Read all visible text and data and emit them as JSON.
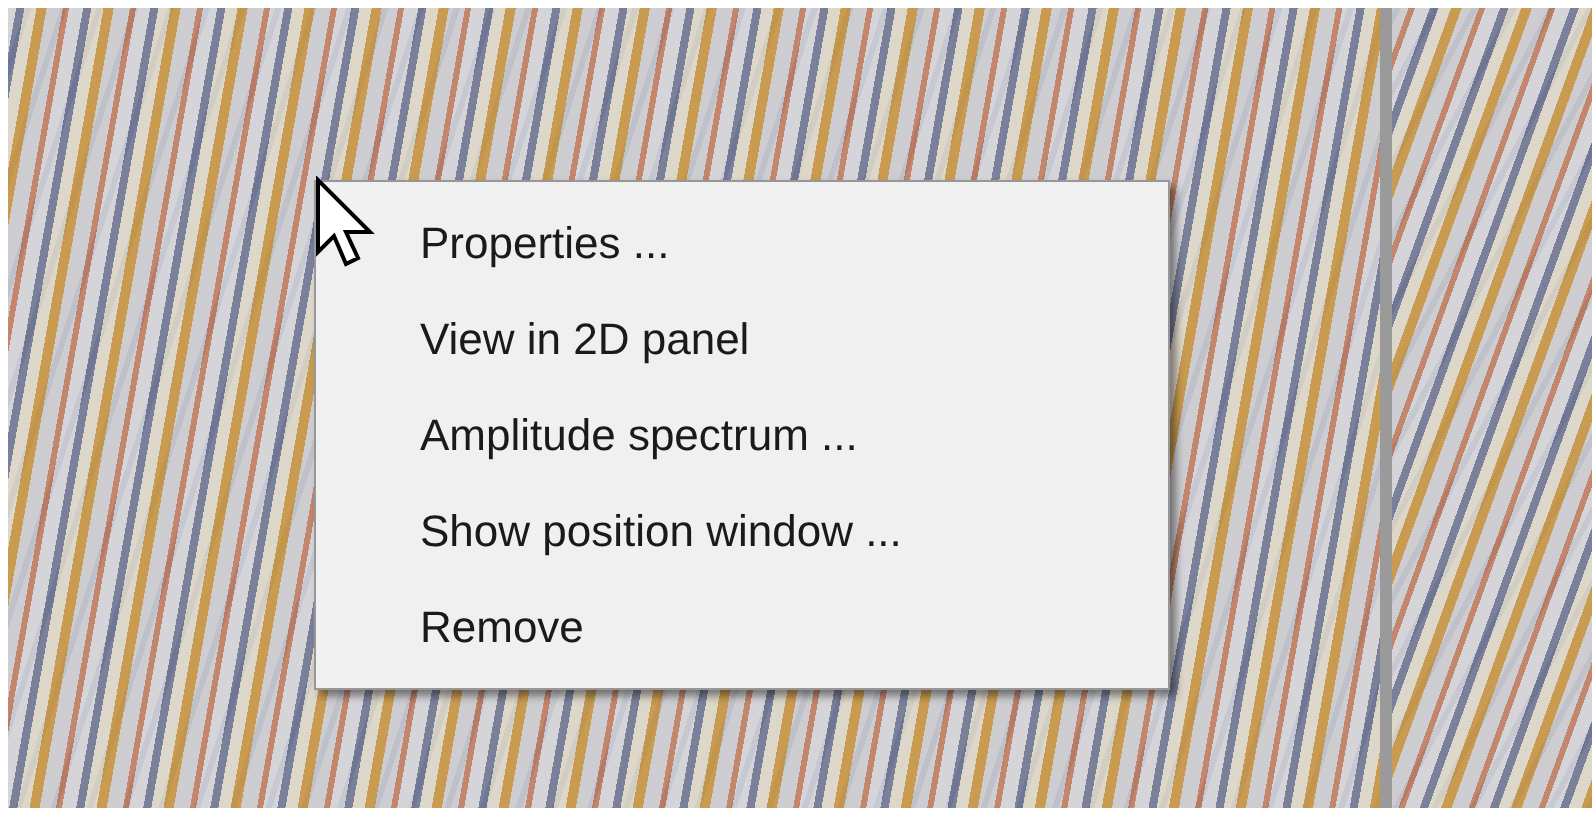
{
  "context_menu": {
    "items": [
      {
        "label": "Properties ..."
      },
      {
        "label": "View in 2D panel"
      },
      {
        "label": "Amplitude spectrum ..."
      },
      {
        "label": "Show position window ..."
      },
      {
        "label": "Remove"
      }
    ]
  }
}
